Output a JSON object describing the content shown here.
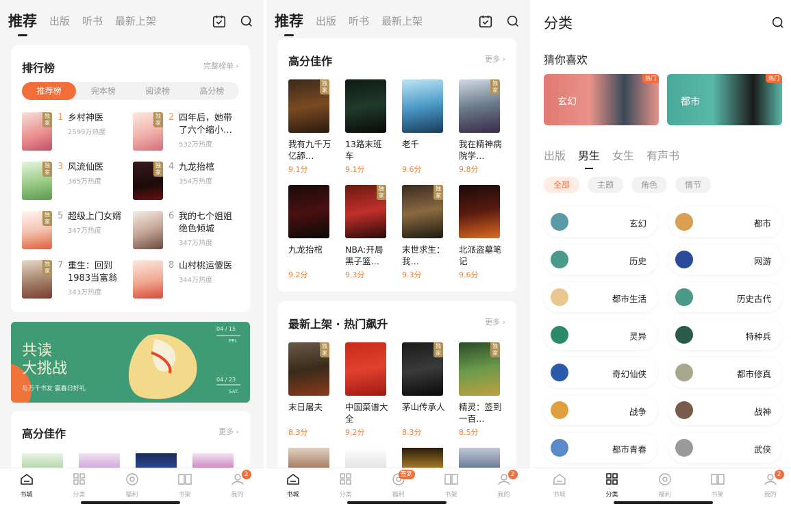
{
  "screen1": {
    "top_tabs": [
      "推荐",
      "出版",
      "听书",
      "最新上架"
    ],
    "rank_card": {
      "title": "排行榜",
      "more": "完整榜单 ›",
      "segments": [
        "推荐榜",
        "完本榜",
        "阅读榜",
        "高分榜"
      ],
      "items": [
        {
          "num": "1",
          "title": "乡村神医",
          "hot": "2599万热度"
        },
        {
          "num": "2",
          "title": "四年后，她带了六个缩小…",
          "hot": "532万热度"
        },
        {
          "num": "3",
          "title": "风流仙医",
          "hot": "365万热度"
        },
        {
          "num": "4",
          "title": "九龙抬棺",
          "hot": "354万热度"
        },
        {
          "num": "5",
          "title": "超级上门女婿",
          "hot": "347万热度"
        },
        {
          "num": "6",
          "title": "我的七个姐姐绝色倾城",
          "hot": "347万热度"
        },
        {
          "num": "7",
          "title": "重生：回到1983当富翁",
          "hot": "343万热度"
        },
        {
          "num": "8",
          "title": "山村桃运傻医",
          "hot": "344万热度"
        }
      ]
    },
    "banner": {
      "line1": "共读",
      "line2": "大挑战",
      "sub": "与万千书友  赢春日好礼",
      "date_top": "04 / 15",
      "date_top_day": "FRI.",
      "date_bottom": "04 / 23",
      "date_bottom_day": "SAT."
    },
    "high_card": {
      "title": "高分佳作",
      "more": "更多 ›"
    }
  },
  "screen2": {
    "top_tabs": [
      "推荐",
      "出版",
      "听书",
      "最新上架"
    ],
    "high_card": {
      "title": "高分佳作",
      "more": "更多 ›",
      "books": [
        {
          "title": "我有九千万亿舔…",
          "score": "9.1分"
        },
        {
          "title": "13路末班车",
          "score": "9.1分"
        },
        {
          "title": "老千",
          "score": "9.6分"
        },
        {
          "title": "我在精神病院学…",
          "score": "9.8分"
        },
        {
          "title": "九龙抬棺",
          "score": "9.2分"
        },
        {
          "title": "NBA:开局黑子篮…",
          "score": "9.3分"
        },
        {
          "title": "末世求生：我…",
          "score": "9.3分"
        },
        {
          "title": "北派盗墓笔记",
          "score": "9.6分"
        }
      ]
    },
    "new_card": {
      "title": "最新上架 · 热门飙升",
      "more": "更多 ›",
      "books": [
        {
          "title": "末日屠夫",
          "score": "8.3分"
        },
        {
          "title": "中国菜谱大全",
          "score": "9.2分"
        },
        {
          "title": "茅山传承人",
          "score": "8.3分"
        },
        {
          "title": "精灵：签到一百…",
          "score": "8.5分"
        }
      ]
    },
    "exclusive_tag": "独家",
    "welfare_badge": "签到"
  },
  "screen3": {
    "title": "分类",
    "guess": "猜你喜欢",
    "hot": [
      {
        "label": "玄幻",
        "badge": "热门"
      },
      {
        "label": "都市",
        "badge": "热门"
      }
    ],
    "sub_tabs": [
      "出版",
      "男生",
      "女生",
      "有声书"
    ],
    "chips": [
      "全部",
      "主题",
      "角色",
      "情节"
    ],
    "genres": [
      "玄幻",
      "都市",
      "历史",
      "网游",
      "都市生活",
      "历史古代",
      "灵异",
      "特种兵",
      "奇幻仙侠",
      "都市修真",
      "战争",
      "战神",
      "都市青春",
      "武侠"
    ]
  },
  "tabbar": [
    "书城",
    "分类",
    "福利",
    "书架",
    "我的"
  ],
  "profile_badge": "2",
  "colors": {
    "accent": "#f36d38",
    "gold": "#b39155",
    "score": "#f08035"
  }
}
